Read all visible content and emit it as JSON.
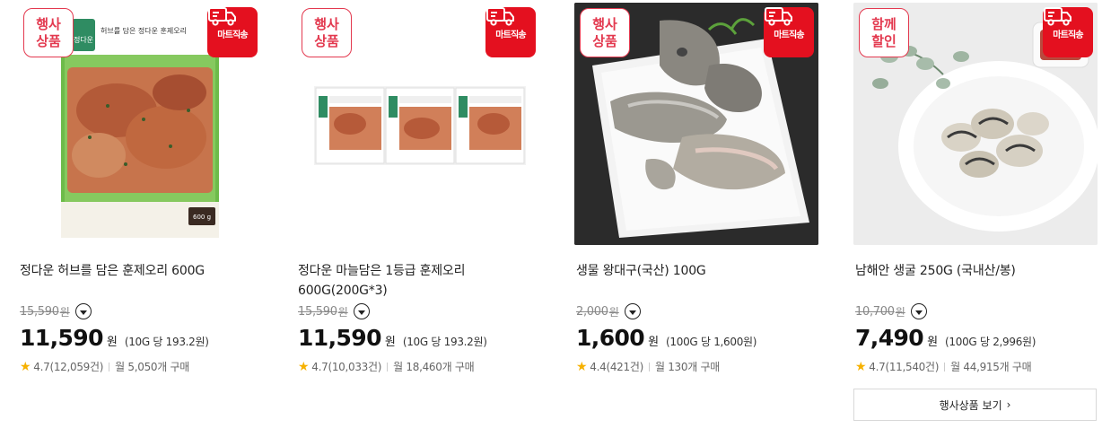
{
  "products": [
    {
      "event_badge": "행사\n상품",
      "delivery_label": "마트직송",
      "image_label": "정다운 허브를 담은 훈제오리 제품 사진",
      "pkg_brand": "정다운",
      "pkg_text": "허브를 담은 정다운 훈제오리",
      "pkg_weight": "600 g",
      "title": "정다운 허브를 담은 훈제오리 600G",
      "original_price": "15,590",
      "original_unit": "원",
      "price": "11,590",
      "price_unit": "원",
      "unit_price": "(10G 당 193.2원)",
      "rating": "4.7(12,059건)",
      "monthly": "월 5,050개 구매"
    },
    {
      "event_badge": "행사\n상품",
      "delivery_label": "마트직송",
      "image_label": "정다운 마늘담은 1등급 훈제오리 제품 사진",
      "pkg_brand": "정다운",
      "title": "정다운 마늘담은 1등급 훈제오리 600G(200G*3)",
      "original_price": "15,590",
      "original_unit": "원",
      "price": "11,590",
      "price_unit": "원",
      "unit_price": "(10G 당 193.2원)",
      "rating": "4.7(10,033건)",
      "monthly": "월 18,460개 구매"
    },
    {
      "event_badge": "행사\n상품",
      "delivery_label": "마트직송",
      "image_label": "생물 왕대구 제품 사진",
      "title": "생물 왕대구(국산) 100G",
      "original_price": "2,000",
      "original_unit": "원",
      "price": "1,600",
      "price_unit": "원",
      "unit_price": "(100G 당 1,600원)",
      "rating": "4.4(421건)",
      "monthly": "월 130개 구매"
    },
    {
      "event_badge": "함께\n할인",
      "delivery_label": "마트직송",
      "image_label": "남해안 생굴 제품 사진",
      "title": "남해안 생굴 250G (국내산/봉)",
      "original_price": "10,700",
      "original_unit": "원",
      "price": "7,490",
      "price_unit": "원",
      "unit_price": "(100G 당 2,996원)",
      "rating": "4.7(11,540건)",
      "monthly": "월 44,915개 구매",
      "more_button": "행사상품 보기"
    }
  ],
  "icons": {
    "delivery": "delivery-truck-icon",
    "info": "chevron-down-icon",
    "star": "star-icon",
    "more": "chevron-right-icon"
  },
  "colors": {
    "event_badge": "#e3394f",
    "delivery_badge": "#e4101f",
    "star": "#f6b100",
    "text": "#222222",
    "muted": "#888888"
  },
  "glyphs": {
    "star": "★",
    "chevron_right": "›"
  }
}
